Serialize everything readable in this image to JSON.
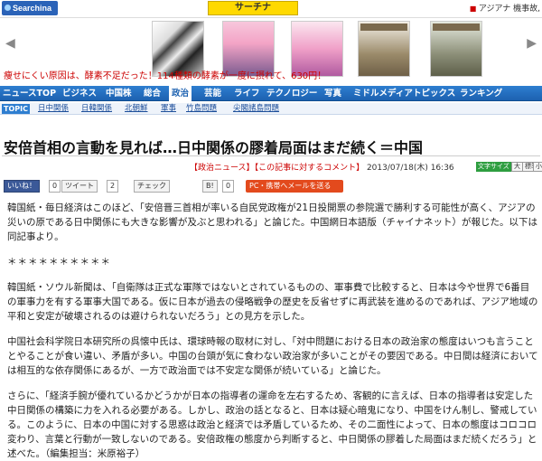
{
  "header": {
    "logo": "Searchina",
    "search_button": "サーチナ",
    "top_right_link": "アジアナ 機事故,"
  },
  "ad_banner": {
    "items": [
      {
        "name": "ad-silver-chain-icon"
      },
      {
        "name": "ad-anime-girls-icon"
      },
      {
        "name": "ad-anime-poster-icon"
      },
      {
        "name": "ad-backpack-icon"
      },
      {
        "name": "ad-bag-icon"
      }
    ],
    "sub_text": "痩せにくい原因は、酵素不足だった！114種類の酵素が一度に摂れて、630円！"
  },
  "nav": {
    "items": [
      {
        "label": "ニュースTOP",
        "active": false
      },
      {
        "label": "ビジネス",
        "active": false
      },
      {
        "label": "中国株",
        "active": false
      },
      {
        "label": "総合",
        "active": false
      },
      {
        "label": "政治",
        "active": true
      },
      {
        "label": "芸能",
        "active": false
      },
      {
        "label": "ライフ",
        "active": false
      },
      {
        "label": "テクノロジー",
        "active": false
      },
      {
        "label": "写真",
        "active": false
      },
      {
        "label": "ミドルメディア",
        "active": false
      },
      {
        "label": "トピックス",
        "active": false
      },
      {
        "label": "ランキング",
        "active": false
      }
    ]
  },
  "subnav": {
    "tag": "TOPIC",
    "items": [
      "日中関係",
      "日韓関係",
      "北朝鮮",
      "軍事",
      "竹島問題",
      "尖閣諸島問題"
    ]
  },
  "article": {
    "title": "安倍首相の言動を見れば…日中関係の膠着局面はまだ続く＝中国",
    "category_link": "【政治ニュース】",
    "comment_link": "【この記事に対するコメント】",
    "date": "2013/07/18(木) 16:36",
    "text_size_label": "文字サイズ",
    "size_options": [
      "大",
      "標準",
      "小"
    ],
    "paragraphs": [
      "韓国紙・毎日経済はこのほど、「安倍晋三首相が率いる自民党政権が21日投開票の参院選で勝利する可能性が高く、アジアの災いの原である日中関係にも大きな影響が及ぶと思われる」と論じた。中国網日本語版（チャイナネット）が報じた。以下は同記事より。",
      "＊＊＊＊＊＊＊＊＊＊",
      "韓国紙・ソウル新聞は、「自衛隊は正式な軍隊ではないとされているものの、軍事費で比較すると、日本は今や世界で6番目の軍事力を有する軍事大国である。仮に日本が過去の侵略戦争の歴史を反省せずに再武装を進めるのであれば、アジア地域の平和と安定が破壊されるのは避けられないだろう」との見方を示した。",
      "中国社会科学院日本研究所の呉懐中氏は、環球時報の取材に対し、「対中問題における日本の政治家の態度はいつも言うこととやることが食い違い、矛盾が多い。中国の台頭が気に食わない政治家が多いことがその要因である。中日間は経済においては相互的な依存関係にあるが、一方で政治面では不安定な関係が続いている」と論じた。",
      "さらに、「経済手腕が優れているかどうかが日本の指導者の運命を左右するため、客観的に言えば、日本の指導者は安定した中日関係の構築に力を入れる必要がある。しかし、政治の話となると、日本は疑心暗鬼になり、中国をけん制し、警戒している。このように、日本の中国に対する思惑は政治と経済では矛盾しているため、その二面性によって、日本の態度はコロコロ変わり、言葉と行動が一致しないのである。安倍政権の態度から判断すると、中日関係の膠着した局面はまだ続くだろう」と述べた。（編集担当：米原裕子）"
    ]
  },
  "social": {
    "like_label": "いいね！",
    "like_count": "0",
    "tweet_label": "ツイート",
    "tweet_count": "2",
    "check_label": "チェック",
    "bookmark_label": "B!",
    "bookmark_count": "0",
    "mail_label": "PC・携帯へメールを送る"
  },
  "colors": {
    "nav_blue": "#1c61b0",
    "link_red": "#cc0000",
    "mail_orange": "#e34a1d"
  }
}
